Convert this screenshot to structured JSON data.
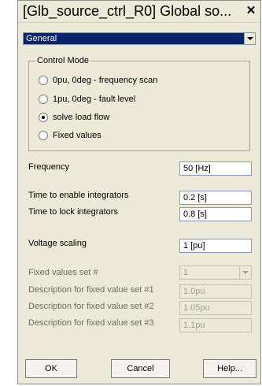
{
  "window": {
    "title": "[Glb_source_ctrl_R0] Global so...",
    "close_glyph": "✕"
  },
  "category": {
    "selected": "General"
  },
  "control_mode": {
    "legend": "Control Mode",
    "options": [
      {
        "label": "0pu, 0deg - frequency scan",
        "checked": false
      },
      {
        "label": "1pu, 0deg - fault level",
        "checked": false
      },
      {
        "label": "solve load flow",
        "checked": true
      },
      {
        "label": "Fixed values",
        "checked": false
      }
    ]
  },
  "fields": {
    "frequency": {
      "label": "Frequency",
      "value": "50 [Hz]"
    },
    "time_enable": {
      "label": "Time to enable integrators",
      "value": "0.2 [s]"
    },
    "time_lock": {
      "label": "Time to lock integrators",
      "value": "0.8 [s]"
    },
    "voltage_scaling": {
      "label": "Voltage scaling",
      "value": "1 [pu]"
    },
    "fixed_set": {
      "label": "Fixed values set #",
      "value": "1"
    },
    "desc1": {
      "label": "Description for fixed value set #1",
      "value": "1.0pu"
    },
    "desc2": {
      "label": "Description for fixed value set #2",
      "value": "1.05pu"
    },
    "desc3": {
      "label": "Description for fixed value set #3",
      "value": "1.1pu"
    }
  },
  "buttons": {
    "ok": "OK",
    "cancel": "Cancel",
    "help": "Help..."
  }
}
